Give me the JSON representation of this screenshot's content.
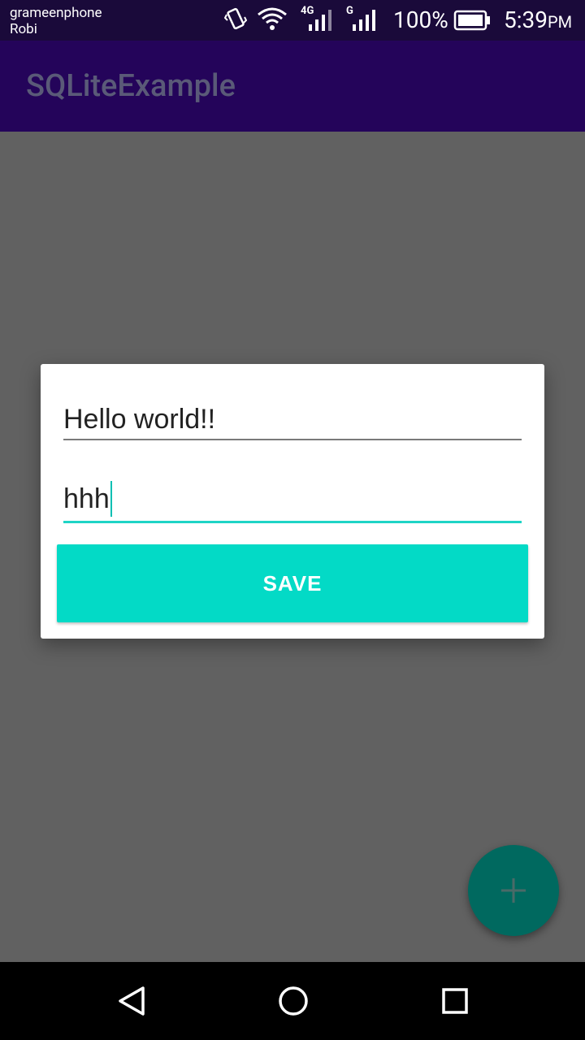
{
  "status_bar": {
    "carrier_1": "grameenphone",
    "carrier_2": "Robi",
    "network_1": "4G",
    "network_2": "G",
    "battery": "100%",
    "time": "5:39",
    "ampm": "PM"
  },
  "app_bar": {
    "title": "SQLiteExample"
  },
  "dialog": {
    "field1_value": "Hello world!!",
    "field2_value": "hhh",
    "save_label": "SAVE"
  },
  "colors": {
    "accent": "#03dac6",
    "primary_dark": "#24045a",
    "fab": "#00695f"
  },
  "icons": {
    "fab": "add-icon",
    "nav_back": "back-triangle-icon",
    "nav_home": "home-circle-icon",
    "nav_recents": "recents-square-icon"
  }
}
